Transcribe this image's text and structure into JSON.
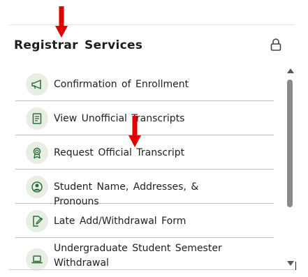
{
  "panel": {
    "title": "Registrar Services"
  },
  "icons": {
    "lock": "lock-icon",
    "annotation_arrow": "red-down-arrow-icon"
  },
  "colors": {
    "icon_background": "#e7efe5",
    "icon_foreground": "#2f6b3a",
    "annotation_arrow": "#e00000"
  },
  "items": [
    {
      "label": "Confirmation of Enrollment",
      "icon": "megaphone-icon"
    },
    {
      "label": "View Unofficial Transcripts",
      "icon": "document-icon"
    },
    {
      "label": "Request Official Transcript",
      "icon": "award-icon"
    },
    {
      "label": "Student Name, Addresses, & Pronouns",
      "icon": "user-icon"
    },
    {
      "label": "Late Add/Withdrawal Form",
      "icon": "edit-document-icon"
    },
    {
      "label": "Undergraduate Student Semester Withdrawal",
      "icon": "laptop-icon"
    }
  ]
}
